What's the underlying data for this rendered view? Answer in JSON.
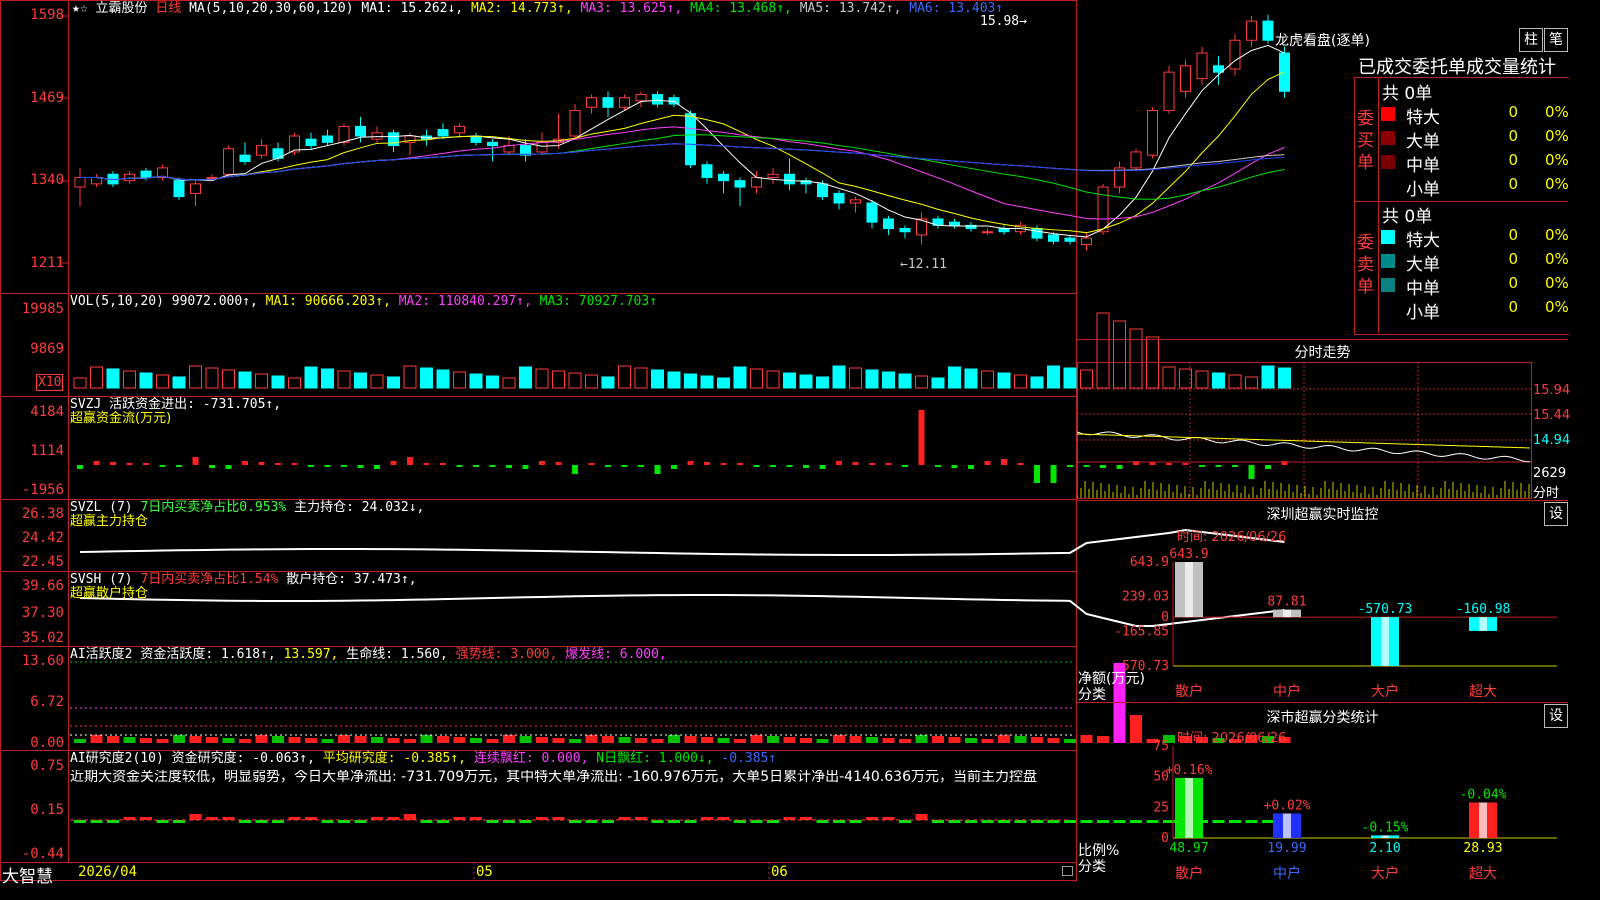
{
  "app": {
    "brand": "大智慧",
    "tab_marks": "★☆"
  },
  "stock": {
    "name": "立霸股份",
    "period": "日线"
  },
  "main_chart": {
    "ma_label": "MA(5,10,20,30,60,120)",
    "ma1": "MA1: 15.262↓,",
    "ma2": "MA2: 14.773↑,",
    "ma3": "MA3: 13.625↑,",
    "ma4": "MA4: 13.468↑,",
    "ma5": "MA5: 13.742↑,",
    "ma6": "MA6: 13.403↑",
    "high_mark": "15.98→",
    "low_mark": "←12.11",
    "y_ticks": [
      "1598",
      "1469",
      "1340",
      "1211"
    ]
  },
  "vol_panel": {
    "label": "VOL(5,10,20)",
    "value": "99072.000↑,",
    "ma1": "MA1: 90666.203↑,",
    "ma2": "MA2: 110840.297↑,",
    "ma3": "MA3: 70927.703↑",
    "y_ticks": [
      "19985",
      "9869"
    ],
    "unit": "X10"
  },
  "svzj_panel": {
    "label": "SVZJ  活跃资金进出: -731.705↑,",
    "sub": "超赢资金流(万元)",
    "y_ticks": [
      "4184",
      "1114",
      "-1956"
    ]
  },
  "svzl_panel": {
    "label": "SVZL (7)",
    "ratio": "7日内买卖净占比0.953%",
    "hold": "主力持仓: 24.032↓,",
    "sub": "超赢主力持仓",
    "y_ticks": [
      "26.38",
      "24.42",
      "22.45"
    ]
  },
  "svsh_panel": {
    "label": "SVSH (7)",
    "ratio": "7日内买卖净占比1.54%",
    "hold": "散户持仓: 37.473↑,",
    "sub": "超赢散户持仓",
    "y_ticks": [
      "39.66",
      "37.30",
      "35.02"
    ]
  },
  "ai_active_panel": {
    "label": "AI活跃度2",
    "a": "资金活跃度: 1.618↑,",
    "b": "13.597,",
    "c": "生命线: 1.560,",
    "d": "强势线: 3.000,",
    "e": "爆发线: 6.000,",
    "y_ticks": [
      "13.60",
      "6.72",
      "0.00"
    ]
  },
  "ai_research_panel": {
    "label": "AI研究度2(10)",
    "a": "资金研究度: -0.063↑,",
    "b": "平均研究度: -0.385↑,",
    "c": "连续飘红: 0.000,",
    "d": "N日飘红: 1.000↓,",
    "e": "-0.385↑",
    "note": "近期大资金关注度较低，明显弱势，今日大单净流出: -731.709万元，其中特大单净流出: -160.976万元，大单5日累计净出-4140.636万元，当前主力控盘",
    "y_ticks": [
      "0.75",
      "0.15",
      "-0.44"
    ]
  },
  "x_axis": {
    "labels": [
      "2026/04",
      "05",
      "06"
    ]
  },
  "dragon": {
    "title": "龙虎看盘(逐单)",
    "btn1": "柱",
    "btn2": "笔",
    "tab_line": "已成交委托单成交量统计",
    "buy_label": "委买单",
    "sell_label": "委卖单",
    "buy_total": "共 0单",
    "sell_total": "共 0单",
    "rows": [
      {
        "name": "特大",
        "count": "0",
        "pct": "0%"
      },
      {
        "name": "大单",
        "count": "0",
        "pct": "0%"
      },
      {
        "name": "中单",
        "count": "0",
        "pct": "0%"
      },
      {
        "name": "小单",
        "count": "0",
        "pct": "0%"
      }
    ],
    "buy_colors": [
      "#ff0000",
      "#8b0000",
      "#7a0000",
      "#000000"
    ],
    "sell_colors": [
      "#00ffff",
      "#008b8b",
      "#0b8080",
      "#000000"
    ]
  },
  "intraday": {
    "title": "分时走势",
    "y_ticks": [
      "15.94",
      "15.44",
      "14.94"
    ],
    "vol_tick": "2629",
    "vol_label": "分时"
  },
  "realtime": {
    "title": "深圳超赢实时监控",
    "btn": "设",
    "time": "时间: 2026/06/26",
    "y_ticks": [
      "643.9",
      "239.03",
      "0",
      "-165.85",
      "-570.73"
    ],
    "y_label": "净额(万元)",
    "cat_label": "分类",
    "bars": [
      {
        "name": "散户",
        "value": "643.9"
      },
      {
        "name": "中户",
        "value": "87.81"
      },
      {
        "name": "大户",
        "value": "-570.73"
      },
      {
        "name": "超大",
        "value": "-160.98"
      }
    ]
  },
  "classify": {
    "title": "深市超赢分类统计",
    "btn": "设",
    "time": "时间: 2026/06/26",
    "y_ticks": [
      "75",
      "50",
      "25",
      "0"
    ],
    "y_label": "比例%",
    "cat_label": "分类",
    "bars": [
      {
        "name": "散户",
        "value": "48.97",
        "change": "+0.16%"
      },
      {
        "name": "中户",
        "value": "19.99",
        "change": "+0.02%"
      },
      {
        "name": "大户",
        "value": "2.10",
        "change": "-0.15%"
      },
      {
        "name": "超大",
        "value": "28.93",
        "change": "-0.04%"
      }
    ]
  },
  "chart_data": [
    {
      "type": "bar",
      "title": "深圳超赢实时监控",
      "ylabel": "净额(万元)",
      "categories": [
        "散户",
        "中户",
        "大户",
        "超大"
      ],
      "values": [
        643.9,
        87.81,
        -570.73,
        -160.98
      ],
      "ylim": [
        -570.73,
        643.9
      ]
    },
    {
      "type": "bar",
      "title": "深市超赢分类统计",
      "ylabel": "比例%",
      "categories": [
        "散户",
        "中户",
        "大户",
        "超大"
      ],
      "values": [
        48.97,
        19.99,
        2.1,
        28.93
      ],
      "ylim": [
        0,
        75
      ]
    }
  ]
}
